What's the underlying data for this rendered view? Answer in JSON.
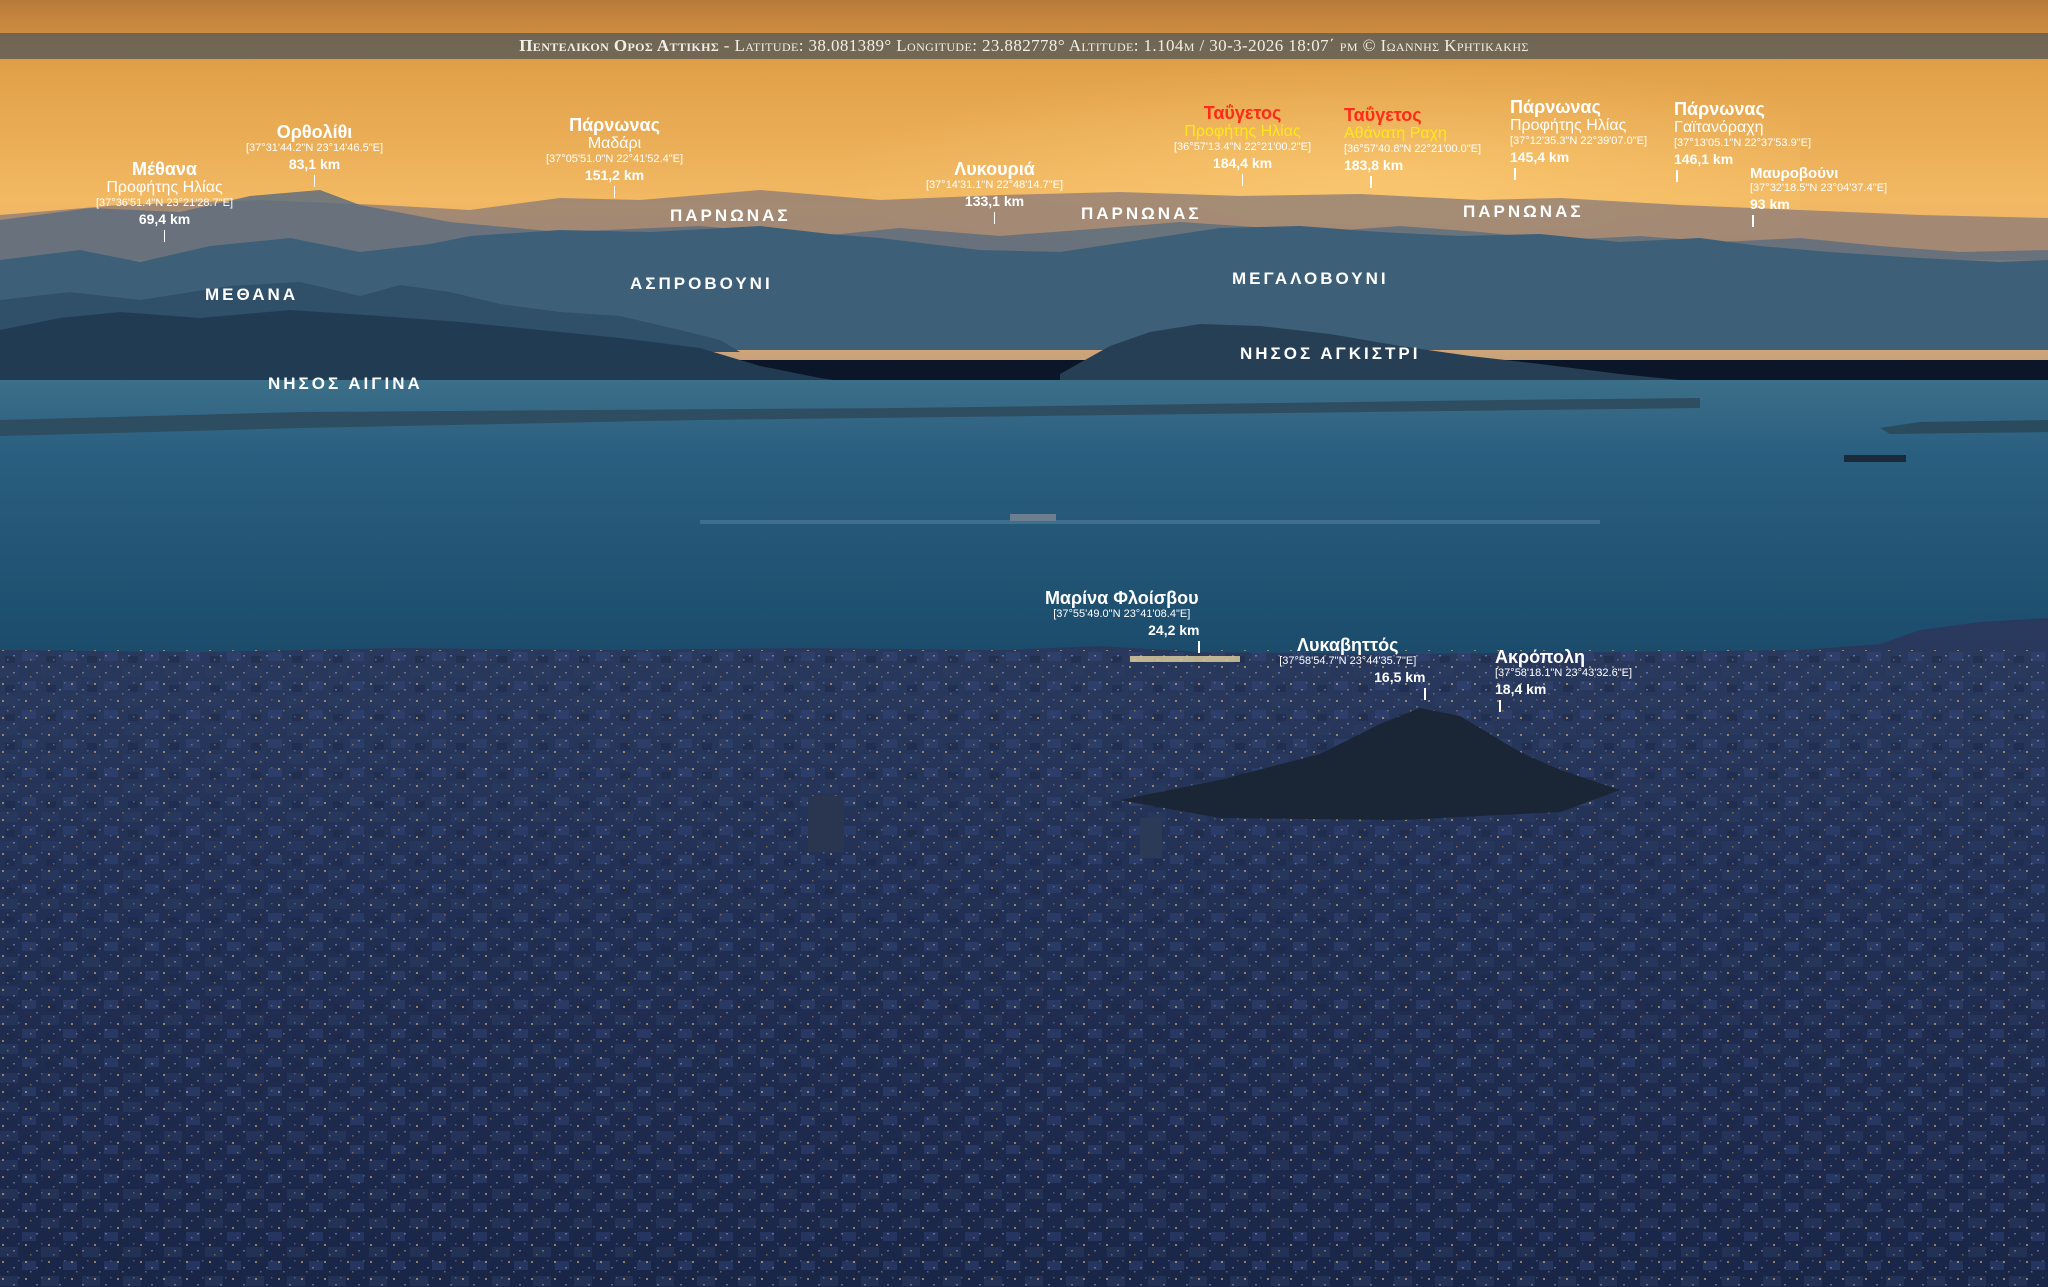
{
  "colors": {
    "sky_top": "#e8a23c",
    "sky_low": "#f0b860",
    "sea": "#1f4f6e",
    "city": "#1e2c52",
    "header_bar": "#5c5c58",
    "highlight_red": "#ff2a18",
    "highlight_yellow": "#ffe81a"
  },
  "header": {
    "title": "Πεντελικον Ορος Αττικης",
    "details": " - Latitude: 38.081389° Longitude: 23.882778°  Altitude: 1.104m / 30-3-2026 18:07΄ pm © Ιωαννης Κρητικακης"
  },
  "peaks": {
    "methana": {
      "name": "Μέθανα",
      "sub": "Προφήτης Ηλίας",
      "coords": "[37°36'51.4\"N 23°21'28.7\"E]",
      "dist": "69,4 km"
    },
    "ortholithi": {
      "name": "Ορθολίθι",
      "coords": "[37°31'44.2\"N 23°14'46.5\"E]",
      "dist": "83,1 km"
    },
    "parnonas_madari": {
      "name": "Πάρνωνας",
      "sub": "Μαδάρι",
      "coords": "[37°05'51.0\"N 22°41'52.4\"E]",
      "dist": "151,2 km"
    },
    "lykouria": {
      "name": "Λυκουριά",
      "coords": "[37°14'31.1\"N 22°48'14.7\"E]",
      "dist": "133,1 km"
    },
    "taygetos_profitis": {
      "name": "Ταΰγετος",
      "sub": "Προφήτης Ηλίας",
      "coords": "[36°57'13.4\"N 22°21'00.2\"E]",
      "dist": "184,4 km"
    },
    "taygetos_athanati": {
      "name": "Ταΰγετος",
      "sub": "Αθάνατη Ραχη",
      "coords": "[36°57'40.8\"N 22°21'00.0\"E]",
      "dist": "183,8 km"
    },
    "parnonas_profitis": {
      "name": "Πάρνωνας",
      "sub": "Προφήτης Ηλίας",
      "coords": "[37°12'35.3\"N 22°39'07.0\"E]",
      "dist": "145,4 km"
    },
    "parnonas_gaitanoraxi": {
      "name": "Πάρνωνας",
      "sub": "Γαϊτανόραχη",
      "coords": "[37°13'05.1\"N 22°37'53.9\"E]",
      "dist": "146,1 km"
    },
    "mavrovouni": {
      "name": "Μαυροβούνι",
      "coords": "[37°32'18.5\"N 23°04'37.4\"E]",
      "dist": "93 km"
    }
  },
  "landmarks": {
    "marina": {
      "name": "Μαρίνα Φλοίσβου",
      "coords": "[37°55'49.0\"N 23°41'08.4\"E]",
      "dist": "24,2 km"
    },
    "lycabettus": {
      "name": "Λυκαβηττός",
      "coords": "[37°58'54.7\"N 23°44'35.7\"E]",
      "dist": "16,5 km"
    },
    "acropolis": {
      "name": "Ακρόπολη",
      "coords": "[37°58'18.1\"N 23°43'32.6\"E]",
      "dist": "18,4 km"
    }
  },
  "regions": {
    "parnonas_1": "ΠΑΡΝΩΝΑΣ",
    "parnonas_2": "ΠΑΡΝΩΝΑΣ",
    "parnonas_3": "ΠΑΡΝΩΝΑΣ",
    "methana": "ΜΕΘΑΝΑ",
    "asprovouni": "ΑΣΠΡΟΒΟΥΝΙ",
    "megalovouni": "ΜΕΓΑΛΟΒΟΥΝΙ",
    "aigina": "ΝΗΣΟΣ ΑΙΓΙΝΑ",
    "agkistri": "ΝΗΣΟΣ ΑΓΚΙΣΤΡΙ"
  }
}
